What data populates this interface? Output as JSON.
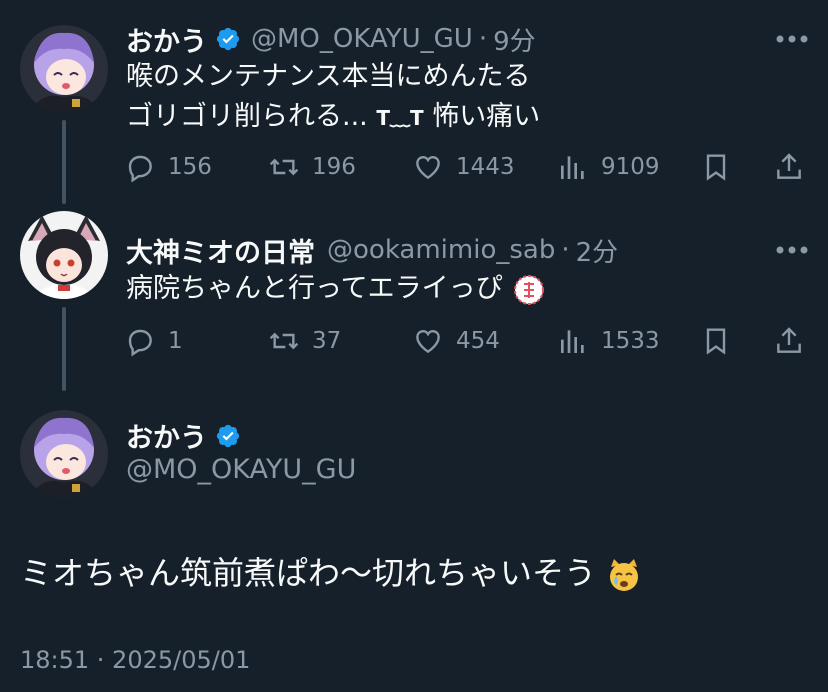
{
  "colors": {
    "background": "#15202b",
    "text": "#f7f9f9",
    "muted": "#8b98a5",
    "verified": "#1d9bf0",
    "thread_line": "#425364"
  },
  "tweet1": {
    "name": "おかう",
    "handle": "@MO_OKAYU_GU",
    "separator": "·",
    "time": "9分",
    "line1": "喉のメンテナンス本当にめんたる",
    "line2_prefix": "ゴリゴリ削られる... ",
    "kaomoji": "T﹏T",
    "line2_suffix": " 怖い痛い",
    "replies": "156",
    "retweets": "196",
    "likes": "1443",
    "views": "9109"
  },
  "tweet2": {
    "name": "大神ミオの日常",
    "handle": "@ookamimio_sab",
    "separator": "·",
    "time": "2分",
    "text": "病院ちゃんと行ってエライっぴ",
    "emoji": "seal-stamp-emoji",
    "replies": "1",
    "retweets": "37",
    "likes": "454",
    "views": "1533"
  },
  "main_tweet": {
    "name": "おかう",
    "handle": "@MO_OKAYU_GU",
    "text": "ミオちゃん筑前煮ぱわ〜切れちゃいそう",
    "emoji": "crying-cat-emoji",
    "timestamp": "18:51 · 2025/05/01"
  },
  "icons": [
    "verified-badge-icon",
    "more-icon",
    "reply-icon",
    "retweet-icon",
    "like-icon",
    "views-icon",
    "bookmark-icon",
    "share-icon"
  ]
}
